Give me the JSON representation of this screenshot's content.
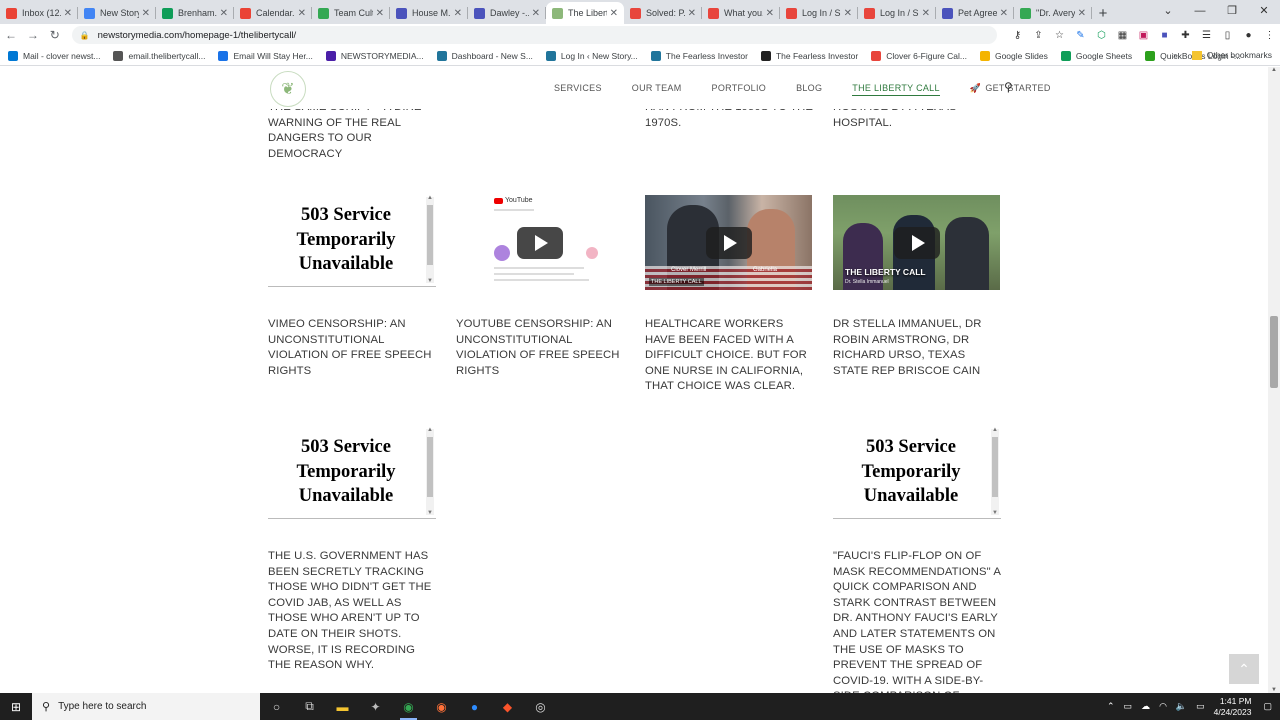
{
  "browser": {
    "tabs": [
      {
        "label": "Inbox (12...",
        "color": "#ea4335"
      },
      {
        "label": "New Story...",
        "color": "#4285f4"
      },
      {
        "label": "Brenham...",
        "color": "#0f9d58"
      },
      {
        "label": "Calendar...",
        "color": "#ea4335"
      },
      {
        "label": "Team Cult...",
        "color": "#34a853"
      },
      {
        "label": "House M...",
        "color": "#4b53bc"
      },
      {
        "label": "Dawley -...",
        "color": "#4b53bc"
      },
      {
        "label": "The Libert...",
        "color": "#8db87a"
      },
      {
        "label": "Solved: P...",
        "color": "#e8453c"
      },
      {
        "label": "What you...",
        "color": "#e8453c"
      },
      {
        "label": "Log In / S...",
        "color": "#e8453c"
      },
      {
        "label": "Log In / S...",
        "color": "#e8453c"
      },
      {
        "label": "Pet Agree...",
        "color": "#4b53bc"
      },
      {
        "label": "\"Dr. Avery...",
        "color": "#34a853"
      }
    ],
    "url": "newstorymedia.com/homepage-1/thelibertycall/",
    "bookmarks": [
      {
        "label": "Mail - clover newst...",
        "color": "#0078d4"
      },
      {
        "label": "email.thelibertycall...",
        "color": "#555555"
      },
      {
        "label": "Email Will Stay Her...",
        "color": "#1a73e8"
      },
      {
        "label": "NEWSTORYMEDIA...",
        "color": "#4b1fa8"
      },
      {
        "label": "Dashboard - New S...",
        "color": "#21759b"
      },
      {
        "label": "Log In ‹ New Story...",
        "color": "#21759b"
      },
      {
        "label": "The Fearless Investor",
        "color": "#21759b"
      },
      {
        "label": "The Fearless Investor",
        "color": "#222222"
      },
      {
        "label": "Clover 6-Figure Cal...",
        "color": "#e8453c"
      },
      {
        "label": "Google Slides",
        "color": "#f4b400"
      },
      {
        "label": "Google Sheets",
        "color": "#0f9d58"
      },
      {
        "label": "QuickBooks Login -...",
        "color": "#2ca01c"
      }
    ],
    "other_bookmarks": "Other bookmarks"
  },
  "site": {
    "nav": [
      "SERVICES",
      "OUR TEAM",
      "PORTFOLIO",
      "BLOG",
      "THE LIBERTY CALL",
      "GET STARTED"
    ]
  },
  "captions_top": {
    "col1": "THE SAME SCRIPT – A DIRE WARNING OF THE REAL DANGERS TO OUR DEMOCRACY",
    "col3": "RAN FROM THE 1950S TO THE 1970S.",
    "col4": "HOSTAGE BY A TEXAS HOSPITAL."
  },
  "row1": {
    "embed_error": "503 Service Temporarily Unavailable",
    "yt_brand": "YouTube",
    "hc_name_left": "Clover Merrill",
    "hc_name_right": "Gabriella",
    "badge": "THE LIBERTY CALL",
    "dr_title": "THE LIBERTY CALL",
    "dr_sub": "Dr. Stella Immanuel",
    "captions": [
      "VIMEO CENSORSHIP: AN UNCONSTITUTIONAL VIOLATION OF FREE SPEECH RIGHTS",
      "YOUTUBE CENSORSHIP: AN UNCONSTITUTIONAL VIOLATION OF FREE SPEECH RIGHTS",
      "HEALTHCARE WORKERS HAVE BEEN FACED WITH A DIFFICULT CHOICE. BUT FOR ONE NURSE IN CALIFORNIA, THAT CHOICE WAS CLEAR.",
      "DR STELLA IMMANUEL, DR ROBIN ARMSTRONG, DR RICHARD URSO, TEXAS STATE REP BRISCOE CAIN"
    ]
  },
  "row2": {
    "embed_error": "503 Service Temporarily Unavailable",
    "captions": [
      "THE U.S. GOVERNMENT HAS BEEN SECRETLY TRACKING THOSE WHO DIDN'T GET THE COVID JAB, AS WELL AS THOSE WHO AREN'T UP TO DATE ON THEIR SHOTS. WORSE, IT IS RECORDING THE REASON WHY.",
      "\"FAUCI'S FLIP-FLOP ON OF MASK RECOMMENDATIONS\" A QUICK COMPARISON AND STARK CONTRAST BETWEEN DR. ANTHONY FAUCI'S EARLY AND LATER STATEMENTS ON THE USE OF MASKS TO PREVENT THE SPREAD OF COVID-19. WITH A SIDE-BY-SIDE COMPARISON OF"
    ]
  },
  "taskbar": {
    "search_placeholder": "Type here to search",
    "time": "1:41 PM",
    "date": "4/24/2023"
  }
}
